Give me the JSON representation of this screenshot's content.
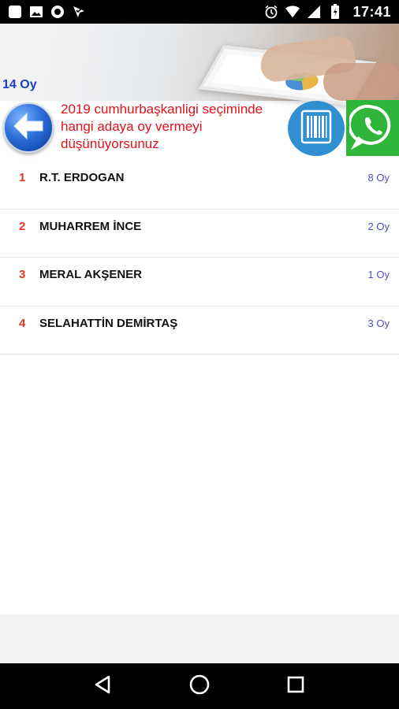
{
  "status_bar": {
    "time": "17:41",
    "left_icons": [
      "square-notification-icon",
      "image-icon",
      "circle-icon",
      "download-check-icon"
    ],
    "right_icons": [
      "alarm-icon",
      "wifi-icon",
      "signal-icon",
      "battery-icon"
    ]
  },
  "header": {
    "total_votes": "14 Oy",
    "question": "2019 cumhurbaşkanligi seçiminde hangi adaya oy vermeyi düşünüyorsunuz",
    "icons": {
      "back": "back-arrow-icon",
      "barcode": "barcode-icon",
      "whatsapp": "whatsapp-icon"
    },
    "colors": {
      "question": "#e0121b",
      "total_votes": "#1a3ec9",
      "whatsapp": "#2fb53a",
      "barcode": "#2f8fd0"
    }
  },
  "candidates": [
    {
      "rank": "1",
      "name": "R.T. ERDOGAN",
      "votes": "8 Oy"
    },
    {
      "rank": "2",
      "name": "MUHARREM İNCE",
      "votes": "2 Oy"
    },
    {
      "rank": "3",
      "name": "MERAL AKŞENER",
      "votes": "1 Oy"
    },
    {
      "rank": "4",
      "name": "SELAHATTİN DEMİRTAŞ",
      "votes": "3 Oy"
    }
  ],
  "navigation": {
    "buttons": [
      "back-triangle-icon",
      "home-circle-icon",
      "recents-square-icon"
    ]
  }
}
